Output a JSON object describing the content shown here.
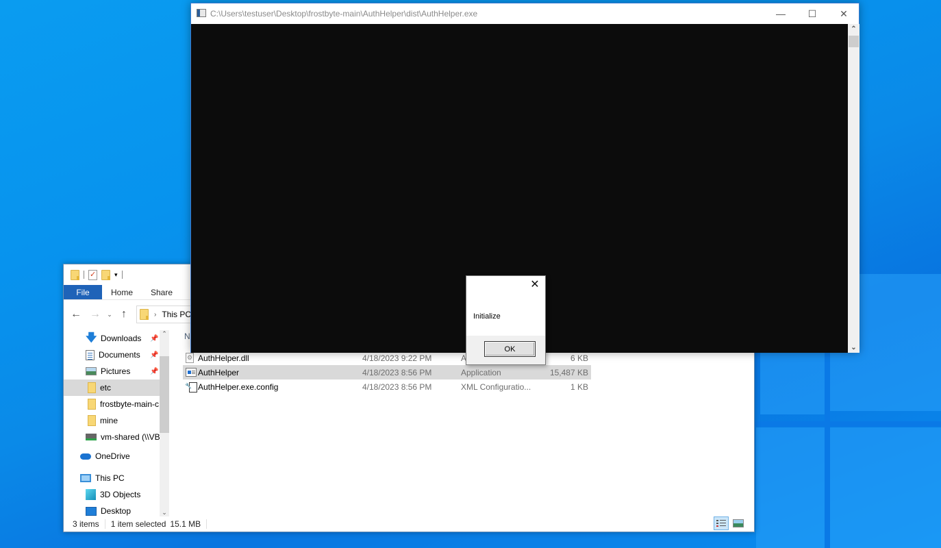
{
  "console_window": {
    "title": "C:\\Users\\testuser\\Desktop\\frostbyte-main\\AuthHelper\\dist\\AuthHelper.exe",
    "minimize_glyph": "—",
    "maximize_glyph": "☐",
    "close_glyph": "✕",
    "scroll_up_glyph": "⌃",
    "scroll_down_glyph": "⌄"
  },
  "message_box": {
    "message": "Initialize",
    "ok_label": "OK",
    "close_glyph": "✕"
  },
  "explorer": {
    "qat": {
      "customize_glyph": "▾"
    },
    "ribbon_tabs": [
      {
        "label": "File"
      },
      {
        "label": "Home"
      },
      {
        "label": "Share"
      }
    ],
    "nav": {
      "back_glyph": "←",
      "forward_glyph": "→",
      "recent_glyph": "⌄",
      "up_glyph": "↑",
      "address_separator": "›",
      "address_path": "This PC"
    },
    "navpane": {
      "items": [
        {
          "label": "Downloads",
          "pinned": true
        },
        {
          "label": "Documents",
          "pinned": true
        },
        {
          "label": "Pictures",
          "pinned": true
        },
        {
          "label": "etc",
          "selected": true
        },
        {
          "label": "frostbyte-main-c"
        },
        {
          "label": "mine"
        },
        {
          "label": "vm-shared (\\\\VB"
        },
        {
          "label": "OneDrive"
        },
        {
          "label": "This PC"
        },
        {
          "label": "3D Objects"
        },
        {
          "label": "Desktop"
        }
      ],
      "pin_glyph": "📌",
      "scroll_up_glyph": "⌃",
      "scroll_down_glyph": "⌄"
    },
    "filelist": {
      "column_header_partial": "N",
      "rows": [
        {
          "name": "AuthHelper.dll",
          "date": "4/18/2023 9:22 PM",
          "type": "A",
          "size": "6 KB"
        },
        {
          "name": "AuthHelper",
          "date": "4/18/2023 8:56 PM",
          "type": "Application",
          "size": "15,487 KB",
          "selected": true
        },
        {
          "name": "AuthHelper.exe.config",
          "date": "4/18/2023 8:56 PM",
          "type": "XML Configuratio...",
          "size": "1 KB"
        }
      ]
    },
    "status": {
      "item_count": "3 items",
      "selection": "1 item selected",
      "selection_size": "15.1 MB"
    }
  }
}
